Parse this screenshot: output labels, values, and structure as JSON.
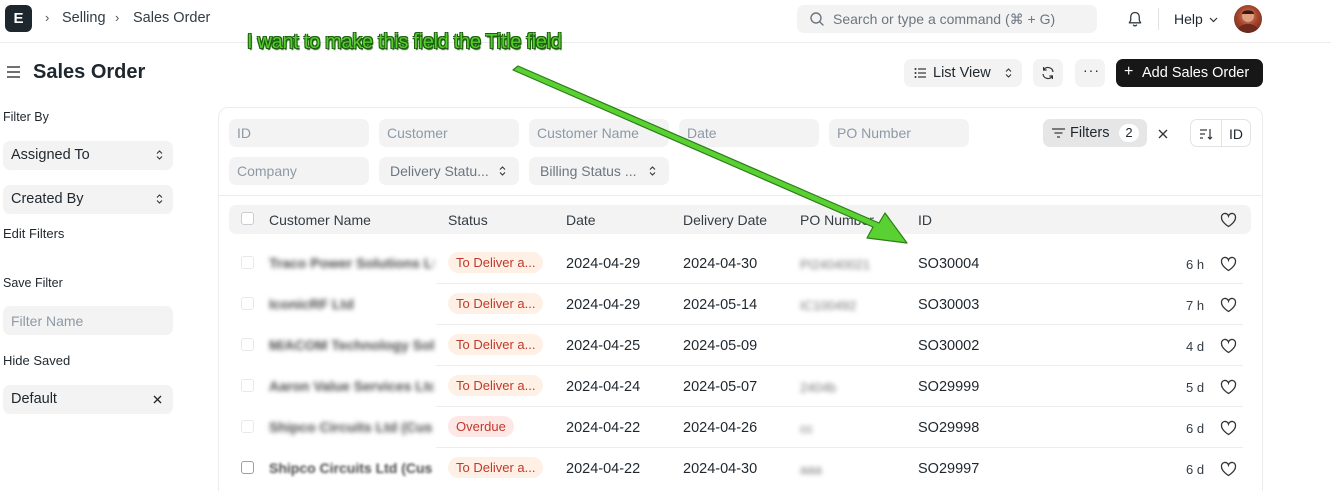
{
  "app": {
    "logo_letter": "E"
  },
  "breadcrumbs": [
    "Selling",
    "Sales Order"
  ],
  "search": {
    "placeholder": "Search or type a command (⌘ + G)"
  },
  "nav": {
    "help_label": "Help"
  },
  "page": {
    "title": "Sales Order"
  },
  "toolbar": {
    "list_view_label": "List View",
    "add_label": "Add Sales Order"
  },
  "sidebar": {
    "filter_by_label": "Filter By",
    "assigned_to": "Assigned To",
    "created_by": "Created By",
    "edit_filters": "Edit Filters",
    "save_filter_label": "Save Filter",
    "filter_name_placeholder": "Filter Name",
    "hide_saved": "Hide Saved",
    "saved_filter": "Default"
  },
  "filters": {
    "id_placeholder": "ID",
    "customer_placeholder": "Customer",
    "customer_name_placeholder": "Customer Name",
    "date_placeholder": "Date",
    "po_number_placeholder": "PO Number",
    "company_placeholder": "Company",
    "delivery_status": "Delivery Statu...",
    "billing_status": "Billing Status ...",
    "filters_label": "Filters",
    "filters_count": "2",
    "sort_label": "ID"
  },
  "table": {
    "columns": [
      "Customer Name",
      "Status",
      "Date",
      "Delivery Date",
      "PO Number",
      "ID"
    ],
    "rows": [
      {
        "customer": "Traco Power Solutions Ltd",
        "status": "To Deliver a...",
        "date": "2024-04-29",
        "delivery_date": "2024-04-30",
        "po": "PI24040021",
        "id": "SO30004",
        "ago": "6 h"
      },
      {
        "customer": "IconicRF Ltd",
        "status": "To Deliver a...",
        "date": "2024-04-29",
        "delivery_date": "2024-05-14",
        "po": "IC100492",
        "id": "SO30003",
        "ago": "7 h"
      },
      {
        "customer": "M/ACOM Technology Solutions",
        "status": "To Deliver a...",
        "date": "2024-04-25",
        "delivery_date": "2024-05-09",
        "po": "",
        "id": "SO30002",
        "ago": "4 d"
      },
      {
        "customer": "Aaron Value Services Ltd",
        "status": "To Deliver a...",
        "date": "2024-04-24",
        "delivery_date": "2024-05-07",
        "po": "2404b",
        "id": "SO29999",
        "ago": "5 d"
      },
      {
        "customer": "Shipco Circuits Ltd (Cus",
        "status": "Overdue",
        "date": "2024-04-22",
        "delivery_date": "2024-04-26",
        "po": "cc",
        "id": "SO29998",
        "ago": "6 d"
      },
      {
        "customer": "Shipco Circuits Ltd (Cus",
        "status": "To Deliver a...",
        "date": "2024-04-22",
        "delivery_date": "2024-04-30",
        "po": "aaa",
        "id": "SO29997",
        "ago": "6 d"
      }
    ]
  },
  "annotation": {
    "text": "I want to make this field the Title field",
    "color": "#56cc2e"
  },
  "colors": {
    "primary_button": "#171717",
    "status_bg": "#fff0e6",
    "status_text": "#c0392b",
    "field_bg": "#f3f3f3"
  }
}
